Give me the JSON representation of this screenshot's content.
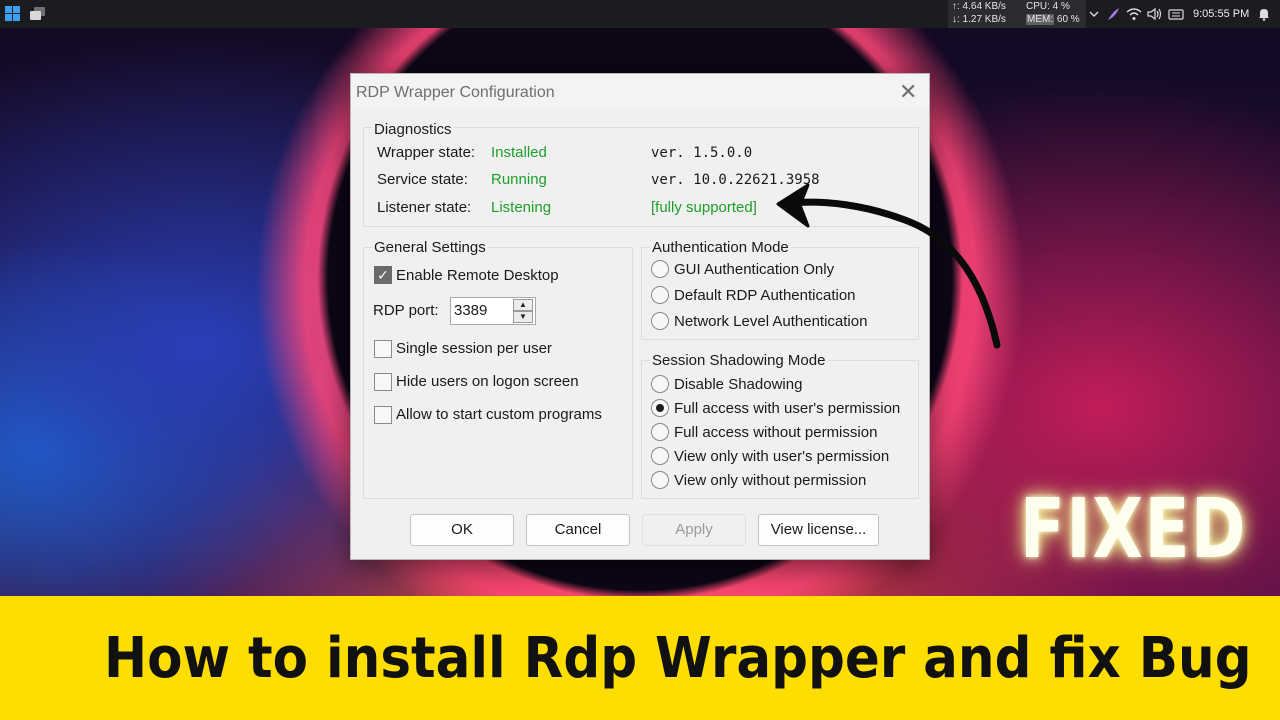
{
  "taskbar": {
    "net_up": "↑: 4.64 KB/s",
    "net_down": "↓: 1.27 KB/s",
    "cpu": "CPU: 4 %",
    "mem_label": "MEM:",
    "mem_value": " 60 %",
    "clock": "9:05:55 PM",
    "icons": [
      "windows-start-icon",
      "task-view-icon",
      "chevron-up-icon",
      "feather-icon",
      "wifi-icon",
      "volume-icon",
      "keyboard-icon",
      "bell-icon"
    ]
  },
  "dialog": {
    "title": "RDP Wrapper Configuration",
    "close_glyph": "✕",
    "diagnostics": {
      "legend": "Diagnostics",
      "wrapper_label": "Wrapper state:",
      "wrapper_value": "Installed",
      "wrapper_version": "ver.  1.5.0.0",
      "service_label": "Service state:",
      "service_value": "Running",
      "service_version": "ver.  10.0.22621.3958",
      "listener_label": "Listener state:",
      "listener_value": "Listening",
      "support_status": "[fully supported]"
    },
    "general": {
      "legend": "General Settings",
      "enable_rdp": "Enable Remote Desktop",
      "enable_rdp_checked": true,
      "port_label": "RDP port:",
      "port_value": "3389",
      "single_session": "Single session per user",
      "hide_users": "Hide users on logon screen",
      "custom_programs": "Allow to start custom programs"
    },
    "auth": {
      "legend": "Authentication Mode",
      "options": [
        "GUI Authentication Only",
        "Default RDP Authentication",
        "Network Level Authentication"
      ]
    },
    "shadow": {
      "legend": "Session Shadowing Mode",
      "options": [
        "Disable Shadowing",
        "Full access with user's permission",
        "Full access without permission",
        "View only with user's permission",
        "View only without permission"
      ],
      "selected_index": 1
    },
    "buttons": {
      "ok": "OK",
      "cancel": "Cancel",
      "apply": "Apply",
      "view_license": "View license..."
    }
  },
  "overlay": {
    "fixed": "FIXED",
    "banner": "How to install Rdp Wrapper and fix Bug",
    "banner_color": "#fede00"
  }
}
